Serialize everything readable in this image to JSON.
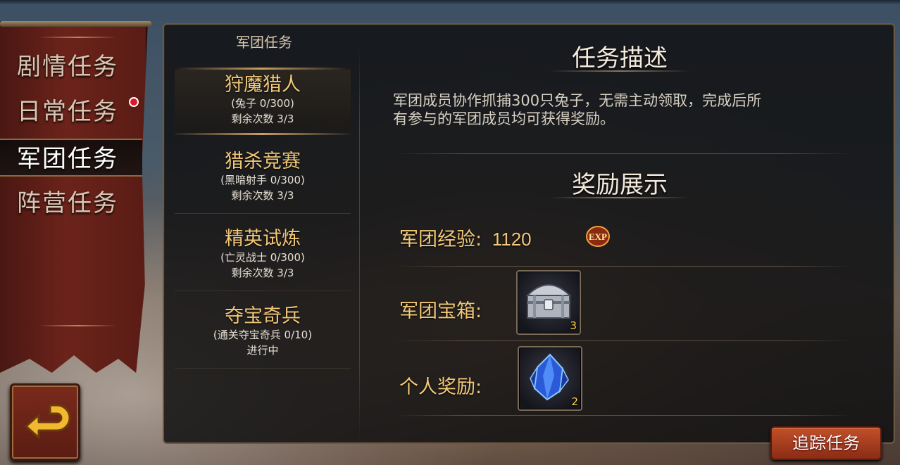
{
  "left_tabs": [
    {
      "label": "剧情任务",
      "has_notification": false
    },
    {
      "label": "日常任务",
      "has_notification": true
    },
    {
      "label": "军团任务",
      "active": true
    },
    {
      "label": "阵营任务"
    }
  ],
  "task_list": {
    "header": "军团任务",
    "tasks": [
      {
        "name": "狩魔猎人",
        "progress": "(兔子 0/300)",
        "status": "剩余次数 3/3",
        "selected": true
      },
      {
        "name": "猎杀竞赛",
        "progress": "(黑暗射手 0/300)",
        "status": "剩余次数 3/3"
      },
      {
        "name": "精英试炼",
        "progress": "(亡灵战士 0/300)",
        "status": "剩余次数 3/3"
      },
      {
        "name": "夺宝奇兵",
        "progress": "(通关夺宝奇兵 0/10)",
        "status": "进行中"
      }
    ]
  },
  "detail": {
    "description_title": "任务描述",
    "description_line1": "军团成员协作抓捕300只兔子，无需主动领取，完成后所",
    "description_line2": "有参与的军团成员均可获得奖励。",
    "reward_title": "奖励展示",
    "rewards": {
      "exp_label": "军团经验",
      "exp_separator": ":",
      "exp_value": "1120",
      "exp_icon_text": "EXP",
      "chest_label": "军团宝箱:",
      "chest_count": "3",
      "personal_label": "个人奖励:",
      "personal_count": "2"
    }
  },
  "track_button": "追踪任务",
  "icons": {
    "back": "back-arrow-icon",
    "exp": "exp-badge-icon",
    "chest": "silver-chest-icon",
    "crystal": "blue-crystal-icon"
  },
  "colors": {
    "gold_text": "#f2c878",
    "banner_red": "#6b231a",
    "notification_red": "#e0182a",
    "button_orange": "#c2502a"
  }
}
